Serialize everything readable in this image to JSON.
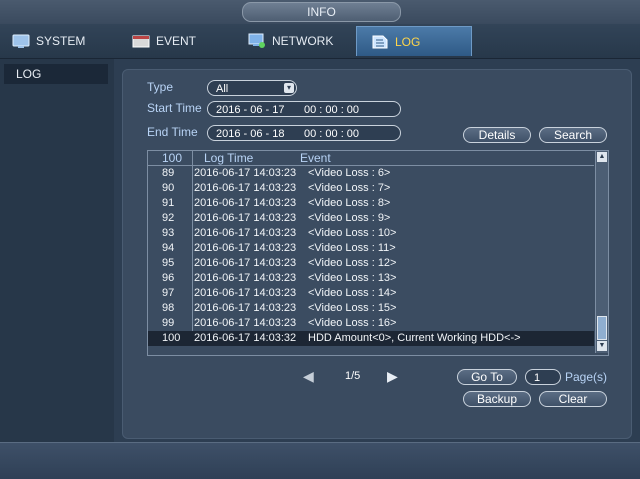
{
  "window": {
    "title": "INFO"
  },
  "tabs": [
    {
      "label": "SYSTEM",
      "icon": "system-icon"
    },
    {
      "label": "EVENT",
      "icon": "event-icon"
    },
    {
      "label": "NETWORK",
      "icon": "network-icon"
    },
    {
      "label": "LOG",
      "icon": "log-icon",
      "active": true
    }
  ],
  "sidebar": {
    "items": [
      {
        "label": "LOG"
      }
    ]
  },
  "filters": {
    "type_label": "Type",
    "type_value": "All",
    "start_label": "Start Time",
    "start_date": "2016 - 06 - 17",
    "start_time": "00 : 00 : 00",
    "end_label": "End Time",
    "end_date": "2016 - 06 - 18",
    "end_time": "00 : 00 : 00",
    "details_label": "Details",
    "search_label": "Search"
  },
  "table": {
    "count": "100",
    "col_time": "Log Time",
    "col_event": "Event",
    "rows": [
      {
        "no": "89",
        "time": "2016-06-17 14:03:23",
        "event": "<Video Loss : 6>"
      },
      {
        "no": "90",
        "time": "2016-06-17 14:03:23",
        "event": "<Video Loss : 7>"
      },
      {
        "no": "91",
        "time": "2016-06-17 14:03:23",
        "event": "<Video Loss : 8>"
      },
      {
        "no": "92",
        "time": "2016-06-17 14:03:23",
        "event": "<Video Loss : 9>"
      },
      {
        "no": "93",
        "time": "2016-06-17 14:03:23",
        "event": "<Video Loss : 10>"
      },
      {
        "no": "94",
        "time": "2016-06-17 14:03:23",
        "event": "<Video Loss : 11>"
      },
      {
        "no": "95",
        "time": "2016-06-17 14:03:23",
        "event": "<Video Loss : 12>"
      },
      {
        "no": "96",
        "time": "2016-06-17 14:03:23",
        "event": "<Video Loss : 13>"
      },
      {
        "no": "97",
        "time": "2016-06-17 14:03:23",
        "event": "<Video Loss : 14>"
      },
      {
        "no": "98",
        "time": "2016-06-17 14:03:23",
        "event": "<Video Loss : 15>"
      },
      {
        "no": "99",
        "time": "2016-06-17 14:03:23",
        "event": "<Video Loss : 16>"
      },
      {
        "no": "100",
        "time": "2016-06-17 14:03:32",
        "event": "HDD Amount<0>, Current Working HDD<->",
        "selected": true
      }
    ]
  },
  "pager": {
    "page_text": "1/5",
    "goto_label": "Go To",
    "goto_value": "1",
    "pages_label": "Page(s)",
    "backup_label": "Backup",
    "clear_label": "Clear"
  },
  "icons": {
    "prev": "◀",
    "next": "▶",
    "dropdown": "▾",
    "scroll_up": "▲",
    "scroll_down": "▼"
  }
}
